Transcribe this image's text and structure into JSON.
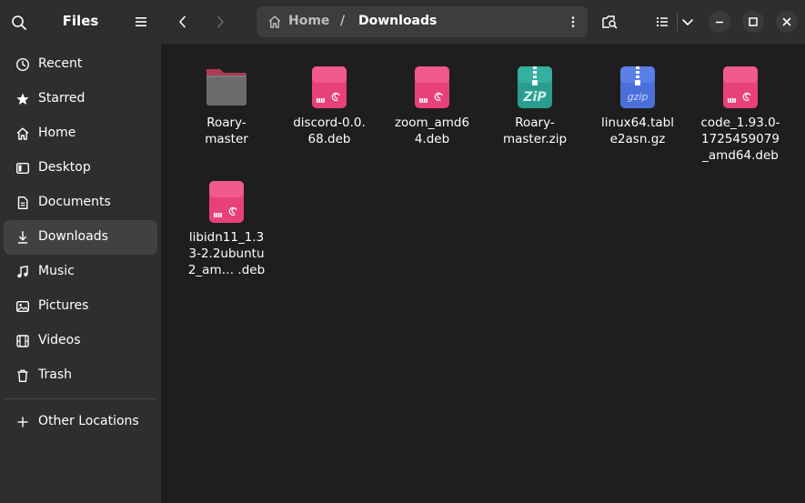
{
  "app": {
    "title": "Files"
  },
  "sidebar": {
    "items": [
      {
        "label": "Recent",
        "icon": "clock-icon"
      },
      {
        "label": "Starred",
        "icon": "star-icon"
      },
      {
        "label": "Home",
        "icon": "home-icon"
      },
      {
        "label": "Desktop",
        "icon": "desktop-icon"
      },
      {
        "label": "Documents",
        "icon": "document-icon"
      },
      {
        "label": "Downloads",
        "icon": "download-icon",
        "active": true
      },
      {
        "label": "Music",
        "icon": "music-icon"
      },
      {
        "label": "Pictures",
        "icon": "picture-icon"
      },
      {
        "label": "Videos",
        "icon": "video-icon"
      },
      {
        "label": "Trash",
        "icon": "trash-icon"
      }
    ],
    "other_locations": "Other Locations"
  },
  "path": {
    "home": "Home",
    "separator": "/",
    "current": "Downloads"
  },
  "files": [
    {
      "name": "Roary-master",
      "type": "folder"
    },
    {
      "name": "discord-0.0.68.deb",
      "type": "deb"
    },
    {
      "name": "zoom_amd64.deb",
      "type": "deb"
    },
    {
      "name": "Roary-master.zip",
      "type": "zip",
      "badge": "ZiP"
    },
    {
      "name": "linux64.table2asn.gz",
      "type": "gzip",
      "badge": "gzip"
    },
    {
      "name": "code_1.93.0-1725459079_amd64.deb",
      "type": "deb"
    },
    {
      "name": "libidn11_1.33-2.2ubuntu2_am… .deb",
      "type": "deb"
    }
  ],
  "file_name_lines": [
    [
      "Roary-",
      "master"
    ],
    [
      "discord-0.0.",
      "68.deb"
    ],
    [
      "zoom_amd6",
      "4.deb"
    ],
    [
      "Roary-",
      "master.zip"
    ],
    [
      "linux64.tabl",
      "e2asn.gz"
    ],
    [
      "code_1.93.0-",
      "1725459079",
      "_amd64.deb"
    ],
    [
      "libidn11_1.3",
      "3-2.2ubuntu",
      "2_am… .deb"
    ]
  ],
  "colors": {
    "sidebar_bg": "#2e2e2e",
    "content_bg": "#1e1e1e",
    "active_item_bg": "#414141",
    "deb_pink": "#e8417a",
    "zip_teal": "#2a9d8f",
    "gzip_blue": "#4a6fd8",
    "folder_grey": "#6b6b6b",
    "folder_tab": "#b03a52"
  }
}
